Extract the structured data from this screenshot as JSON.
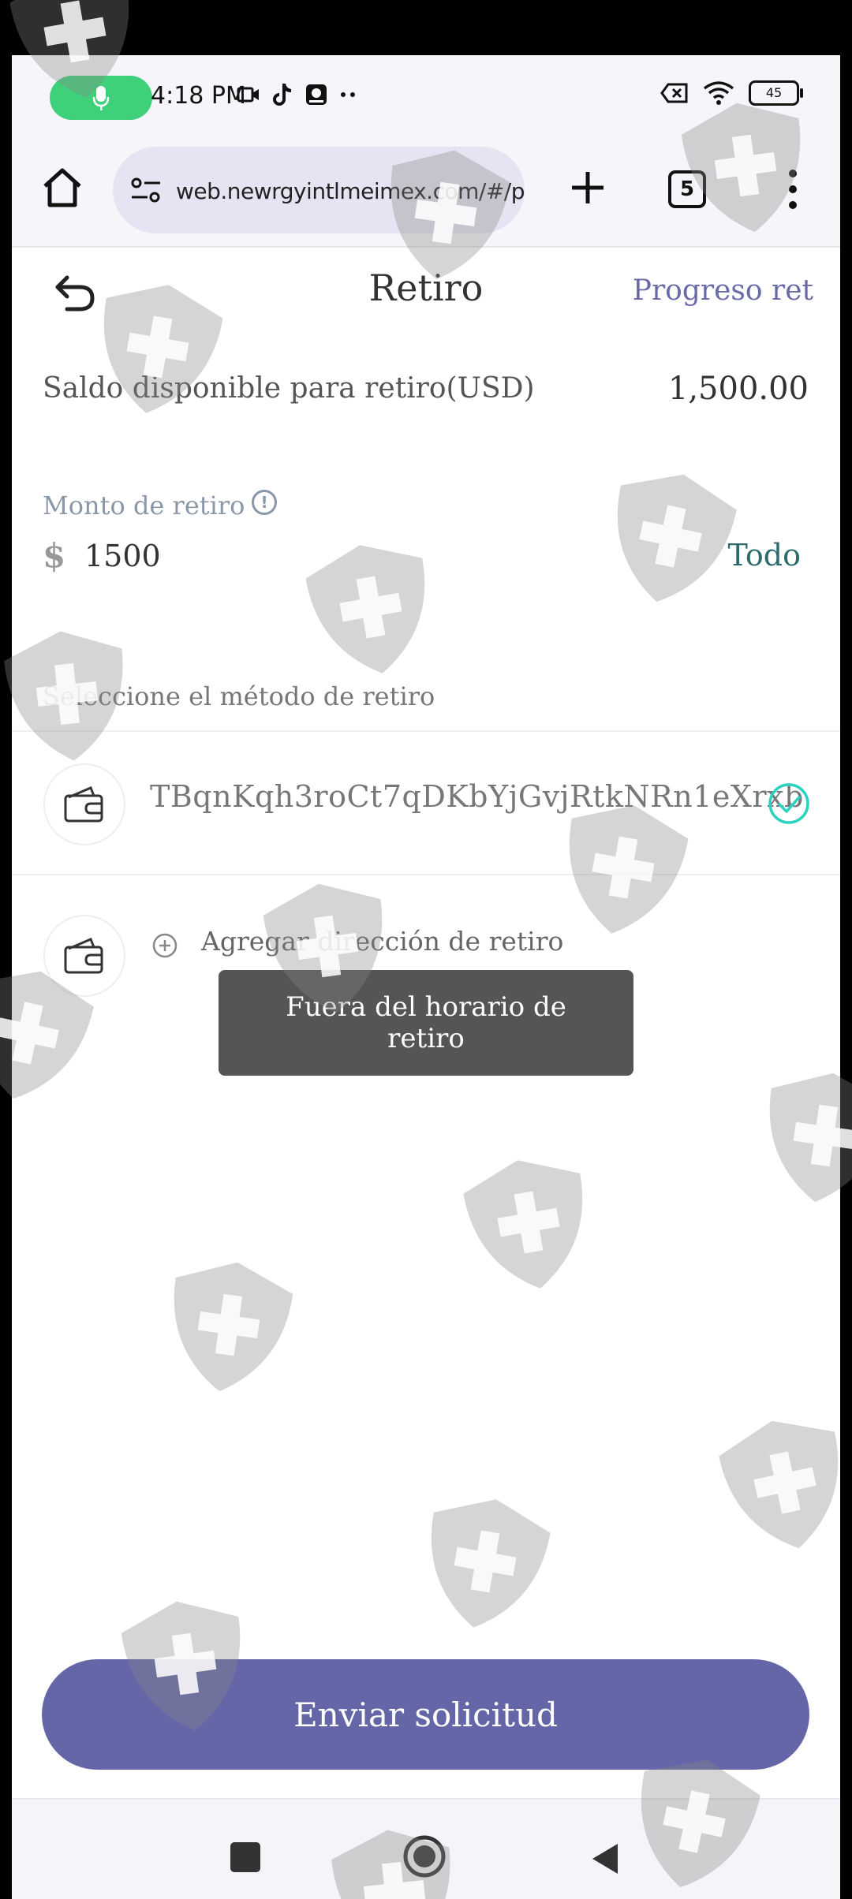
{
  "status_bar": {
    "time": "4:18 PM",
    "battery": "45",
    "accent_color": "#3fd17a"
  },
  "browser": {
    "url": "web.newrgyintlmeimex.com/#/pages",
    "tab_count": "5"
  },
  "header": {
    "title": "Retiro",
    "progress_link": "Progreso ret"
  },
  "balance": {
    "label": "Saldo disponible para retiro(USD)",
    "value": "1,500.00"
  },
  "amount": {
    "label": "Monto de retiro",
    "currency": "$",
    "value": "1500",
    "all_button": "Todo"
  },
  "method": {
    "label": "Seleccione el método de retiro",
    "address": "TBqnKqh3roCt7qDKbYjGvjRtkNRn1eXrxb",
    "add_label": "Agregar dirección de retiro",
    "check_color": "#2ad2c2"
  },
  "toast": {
    "message": "Fuera del horario de retiro"
  },
  "submit": {
    "label": "Enviar solicitud",
    "color": "#6566a8"
  }
}
